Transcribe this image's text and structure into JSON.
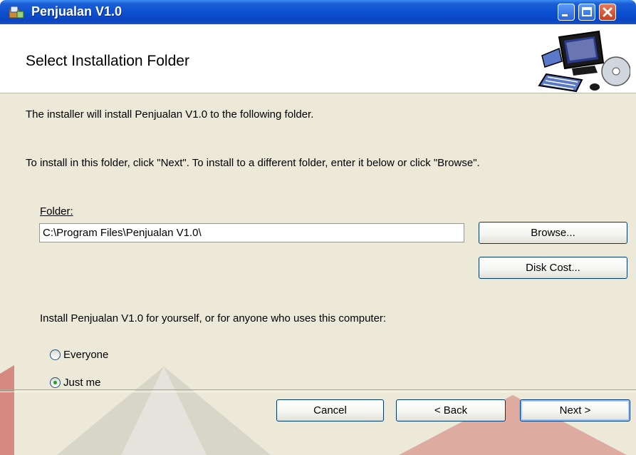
{
  "window": {
    "title": "Penjualan V1.0"
  },
  "header": {
    "title": "Select Installation Folder",
    "graphic_icon": "computer-install-icon"
  },
  "body": {
    "intro_line": "The installer will install Penjualan V1.0 to the following folder.",
    "instructions_line": "To install in this folder, click \"Next\". To install to a different folder, enter it below or click \"Browse\".",
    "folder_label": "Folder:",
    "folder_value": "C:\\Program Files\\Penjualan V1.0\\",
    "browse_label": "Browse...",
    "disk_cost_label": "Disk Cost...",
    "scope_prompt": "Install Penjualan V1.0 for yourself, or for anyone who uses this computer:",
    "options": [
      {
        "label": "Everyone",
        "selected": false
      },
      {
        "label": "Just me",
        "selected": true
      }
    ]
  },
  "footer": {
    "cancel_label": "Cancel",
    "back_label": "< Back",
    "next_label": "Next >"
  },
  "colors": {
    "titlebar": "#0a4fd0",
    "dialog_bg": "#ece9d8",
    "watermark": "#c23a3a"
  }
}
